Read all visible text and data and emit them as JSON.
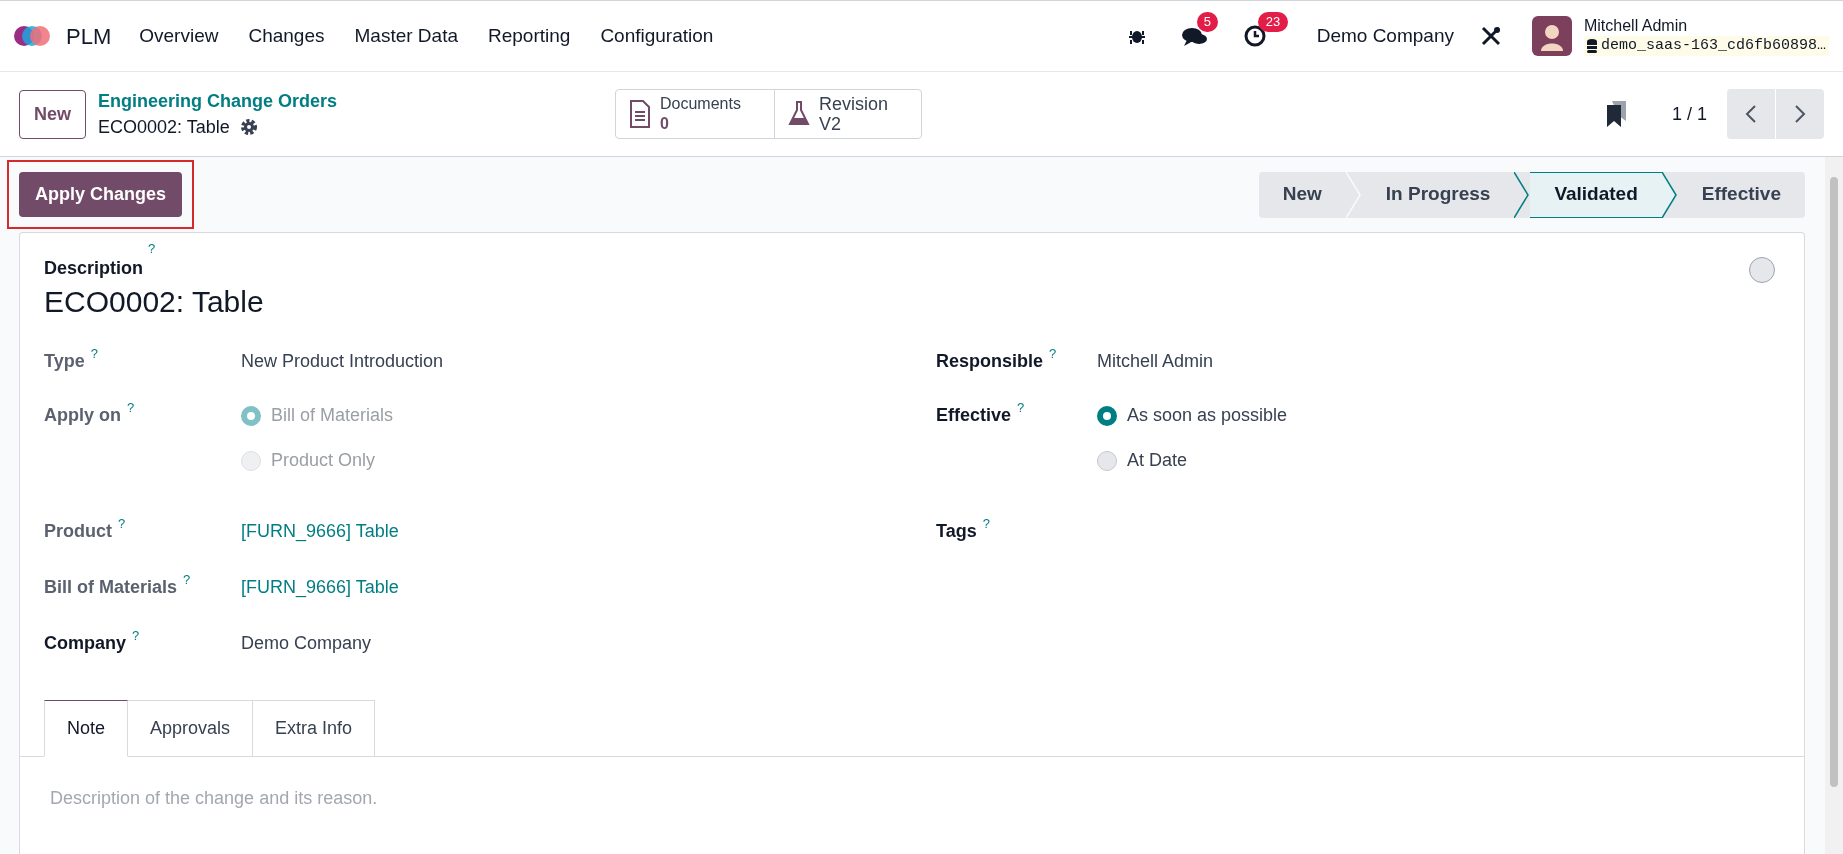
{
  "navbar": {
    "app_name": "PLM",
    "menu": [
      "Overview",
      "Changes",
      "Master Data",
      "Reporting",
      "Configuration"
    ],
    "messages_count": "5",
    "activities_count": "23",
    "company": "Demo Company",
    "user": {
      "name": "Mitchell Admin",
      "database": "demo_saas-163_cd6fb60898…"
    }
  },
  "control_panel": {
    "new_button": "New",
    "breadcrumb": "Engineering Change Orders",
    "record_title": "ECO0002: Table",
    "smart_buttons": [
      {
        "kind": "documents",
        "label": "Documents",
        "value": "0"
      },
      {
        "kind": "revision",
        "label": "Revision",
        "value": "V2"
      }
    ],
    "pager": "1 / 1"
  },
  "action_button": "Apply Changes",
  "stages": [
    {
      "label": "New",
      "selected": false
    },
    {
      "label": "In Progress",
      "selected": false
    },
    {
      "label": "Validated",
      "selected": true
    },
    {
      "label": "Effective",
      "selected": false
    }
  ],
  "form": {
    "description_label": "Description",
    "description_help": "?",
    "title": "ECO0002: Table",
    "left_fields": [
      {
        "label": "Type",
        "help": "?",
        "required": false,
        "kind": "text",
        "value": "New Product Introduction"
      },
      {
        "label": "Apply on",
        "help": "?",
        "required": false,
        "kind": "radio",
        "disabled": true,
        "options": [
          {
            "label": "Bill of Materials",
            "selected": true
          },
          {
            "label": "Product Only",
            "selected": false
          }
        ]
      },
      {
        "label": "Product",
        "help": "?",
        "required": false,
        "kind": "link",
        "value": "[FURN_9666] Table"
      },
      {
        "label": "Bill of Materials",
        "help": "?",
        "required": false,
        "kind": "link",
        "value": "[FURN_9666] Table"
      },
      {
        "label": "Company",
        "help": "?",
        "required": true,
        "kind": "text",
        "value": "Demo Company"
      }
    ],
    "right_fields": [
      {
        "label": "Responsible",
        "help": "?",
        "required": true,
        "kind": "text",
        "value": "Mitchell Admin"
      },
      {
        "label": "Effective",
        "help": "?",
        "required": true,
        "kind": "radio",
        "disabled": false,
        "options": [
          {
            "label": "As soon as possible",
            "selected": true
          },
          {
            "label": "At Date",
            "selected": false
          }
        ]
      },
      {
        "label": "Tags",
        "help": "?",
        "required": true,
        "kind": "text"
      }
    ],
    "tabs": [
      {
        "label": "Note",
        "selected": true
      },
      {
        "label": "Approvals",
        "selected": false
      },
      {
        "label": "Extra Info",
        "selected": false
      }
    ],
    "note": {
      "placeholder": "Description of the change and its reason."
    }
  }
}
